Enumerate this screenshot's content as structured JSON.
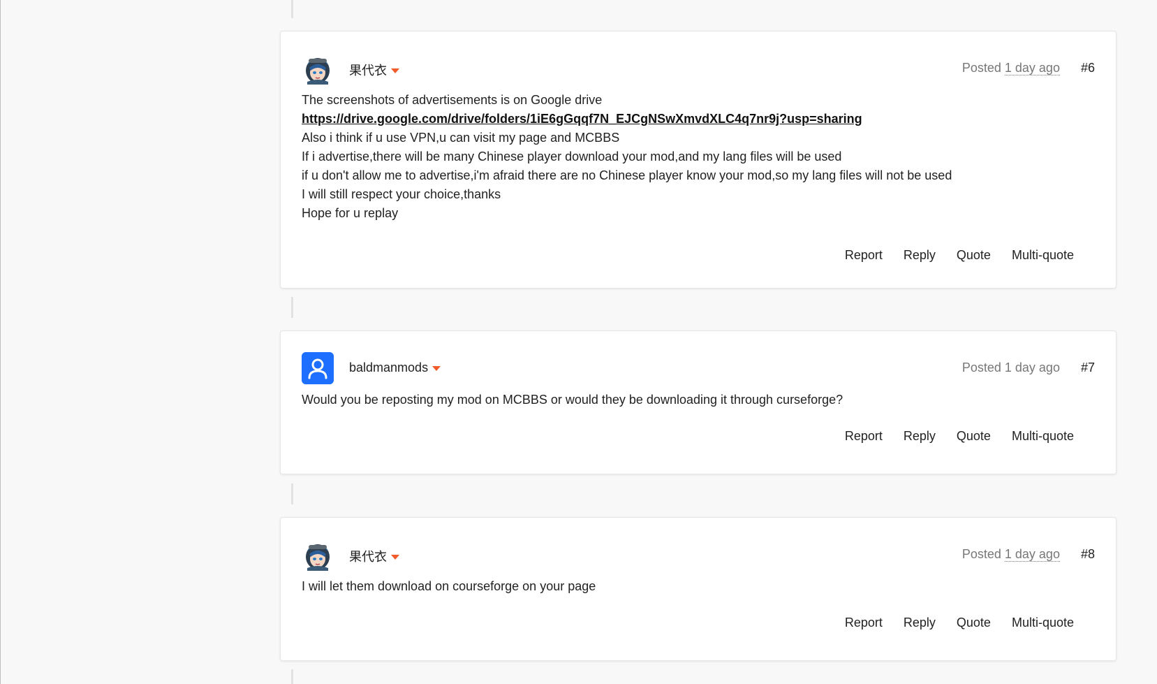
{
  "posts": [
    {
      "author": "果代衣",
      "avatar": "anime-avatar",
      "posted_label": "Posted",
      "time": "1 day ago",
      "number": "#6",
      "body": {
        "line1": "The screenshots of advertisements is on Google drive",
        "link": "https://drive.google.com/drive/folders/1iE6gGqqf7N_EJCgNSwXmvdXLC4q7nr9j?usp=sharing",
        "line3": "Also i think if u use VPN,u can visit my page and MCBBS",
        "line4": "If i advertise,there will be many Chinese player download your mod,and my lang files will be used",
        "line5": "if u don't allow me to advertise,i'm afraid there are no Chinese player know your mod,so my lang files will not be used",
        "line6": "I will still respect your choice,thanks",
        "line7": "Hope for u replay"
      },
      "actions": {
        "report": "Report",
        "reply": "Reply",
        "quote": "Quote",
        "multiquote": "Multi-quote"
      }
    },
    {
      "author": "baldmanmods",
      "avatar": "default-user-avatar",
      "posted_label": "Posted",
      "time": "1 day ago",
      "number": "#7",
      "body": {
        "line1": "Would you be reposting my mod on MCBBS or would they be downloading it through curseforge?"
      },
      "actions": {
        "report": "Report",
        "reply": "Reply",
        "quote": "Quote",
        "multiquote": "Multi-quote"
      }
    },
    {
      "author": "果代衣",
      "avatar": "anime-avatar",
      "posted_label": "Posted",
      "time": "1 day ago",
      "number": "#8",
      "body": {
        "line1": "I will let them download on courseforge on your page"
      },
      "actions": {
        "report": "Report",
        "reply": "Reply",
        "quote": "Quote",
        "multiquote": "Multi-quote"
      }
    }
  ],
  "colors": {
    "accent_caret": "#f15a29",
    "default_avatar_bg": "#1e6fff"
  }
}
